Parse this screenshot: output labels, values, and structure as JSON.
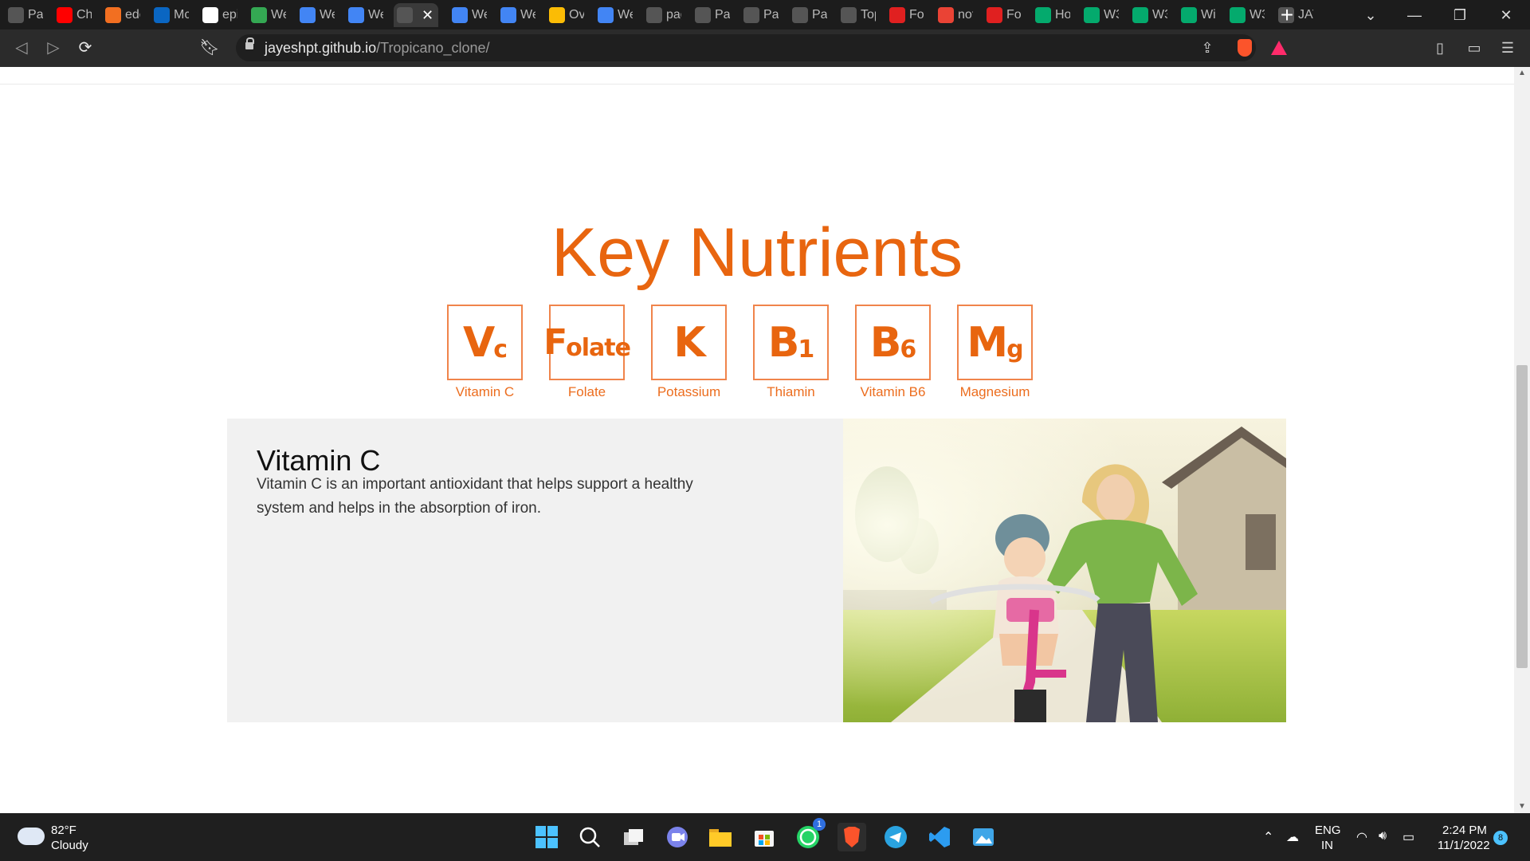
{
  "browser": {
    "tabs": [
      {
        "label": "Pac",
        "icon": "globe-icon"
      },
      {
        "label": "Cha",
        "icon": "youtube-icon",
        "color": "#ff0000"
      },
      {
        "label": "edc",
        "icon": "flame-icon",
        "color": "#f26f21"
      },
      {
        "label": "Mc",
        "icon": "linkedin-icon",
        "color": "#0a66c2"
      },
      {
        "label": "epi",
        "icon": "google-icon",
        "color": "#ffffff"
      },
      {
        "label": "We",
        "icon": "drive-icon",
        "color": "#34a853"
      },
      {
        "label": "We",
        "icon": "docs-icon",
        "color": "#4285f4"
      },
      {
        "label": "We",
        "icon": "docs-icon",
        "color": "#4285f4"
      },
      {
        "label": "",
        "icon": "globe-icon",
        "active": true
      },
      {
        "label": "We",
        "icon": "docs-icon",
        "color": "#4285f4"
      },
      {
        "label": "We",
        "icon": "docs-icon",
        "color": "#4285f4"
      },
      {
        "label": "Ov",
        "icon": "chrome-icon",
        "color": "#fbbc05"
      },
      {
        "label": "We",
        "icon": "docs-icon",
        "color": "#4285f4"
      },
      {
        "label": "pag",
        "icon": "loading-icon"
      },
      {
        "label": "Pac",
        "icon": "globe-icon"
      },
      {
        "label": "Pac",
        "icon": "globe-icon"
      },
      {
        "label": "Pac",
        "icon": "globe-icon"
      },
      {
        "label": "Top",
        "icon": "f-icon"
      },
      {
        "label": "For",
        "icon": "forms-icon",
        "color": "#e02020"
      },
      {
        "label": "not",
        "icon": "gmail-icon",
        "color": "#ea4335"
      },
      {
        "label": "For",
        "icon": "forms-icon",
        "color": "#e02020"
      },
      {
        "label": "Ho",
        "icon": "w3-icon",
        "color": "#04aa6d"
      },
      {
        "label": "W3",
        "icon": "w3-icon",
        "color": "#04aa6d"
      },
      {
        "label": "W3",
        "icon": "w3-icon",
        "color": "#04aa6d"
      },
      {
        "label": "Wi",
        "icon": "w3-icon",
        "color": "#04aa6d"
      },
      {
        "label": "W3",
        "icon": "w3-icon",
        "color": "#04aa6d"
      },
      {
        "label": "JAY",
        "icon": "profile-photo-icon"
      }
    ],
    "url_domain": "jayeshpt.github.io",
    "url_path": "/Tropicano_clone/"
  },
  "page": {
    "title": "Key Nutrients",
    "accent_color": "#e8650f",
    "nutrients": [
      {
        "symbol": "V",
        "sub": "c",
        "label": "Vitamin C"
      },
      {
        "symbol": "F",
        "sub": "olate",
        "label": "Folate"
      },
      {
        "symbol": "K",
        "sub": "",
        "label": "Potassium"
      },
      {
        "symbol": "B",
        "sub": "1",
        "label": "Thiamin"
      },
      {
        "symbol": "B",
        "sub": "6",
        "label": "Vitamin B6"
      },
      {
        "symbol": "M",
        "sub": "g",
        "label": "Magnesium"
      }
    ],
    "detail": {
      "heading": "Vitamin C",
      "text": "Vitamin C is an important antioxidant that helps support a healthy system and helps in the absorption of iron."
    }
  },
  "taskbar": {
    "weather_temp": "82°F",
    "weather_desc": "Cloudy",
    "apps": [
      "start-icon",
      "search-icon",
      "task-view-icon",
      "chat-icon",
      "file-explorer-icon",
      "store-icon",
      "whatsapp-icon",
      "brave-icon",
      "telegram-icon",
      "vscode-icon",
      "photos-icon"
    ],
    "whatsapp_badge": "1",
    "lang_top": "ENG",
    "lang_bottom": "IN",
    "time": "2:24 PM",
    "date": "11/1/2022",
    "notification_count": "8"
  }
}
